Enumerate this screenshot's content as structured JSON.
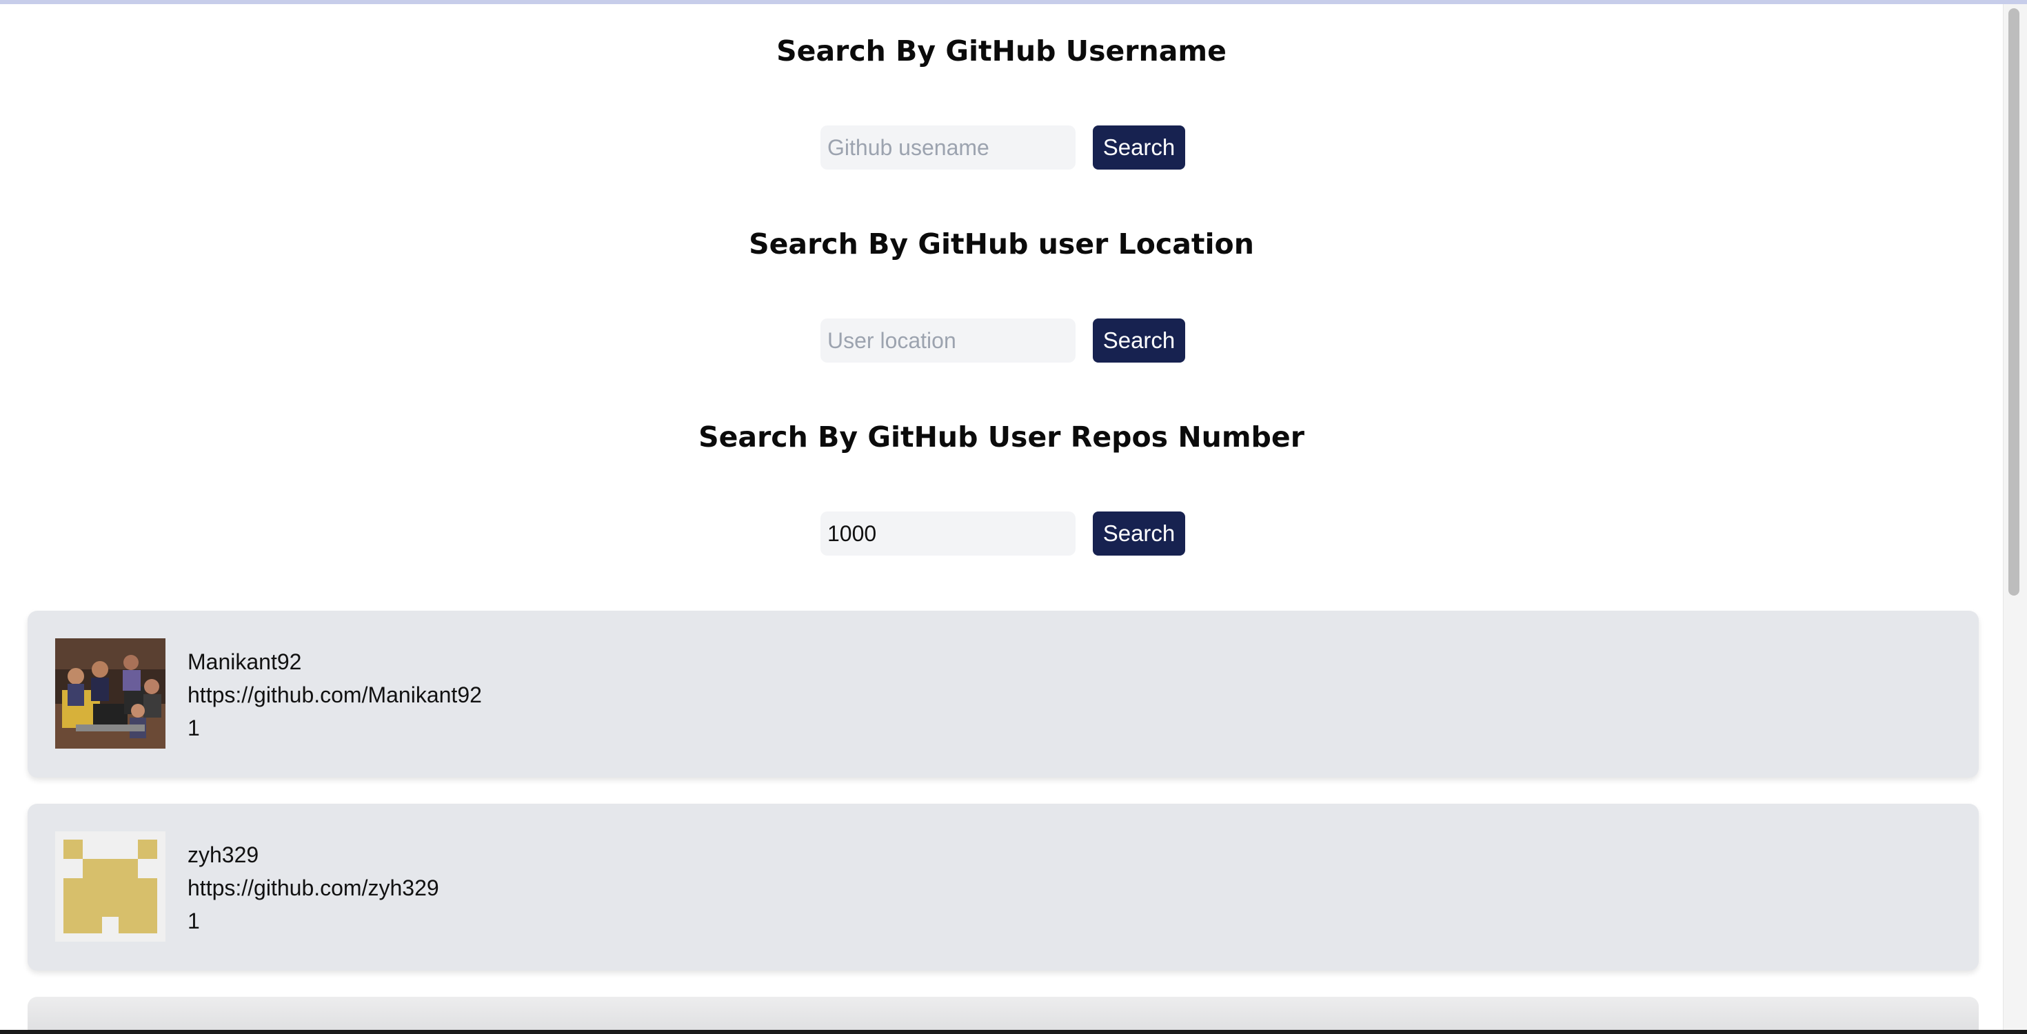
{
  "sections": [
    {
      "title": "Search By GitHub Username",
      "input_value": "",
      "input_placeholder": "Github usename",
      "button_label": "Search"
    },
    {
      "title": "Search By GitHub user Location",
      "input_value": "",
      "input_placeholder": "User location",
      "button_label": "Search"
    },
    {
      "title": "Search By GitHub User Repos Number",
      "input_value": "1000",
      "input_placeholder": "",
      "button_label": "Search"
    }
  ],
  "results": [
    {
      "username": "Manikant92",
      "profile_url": "https://github.com/Manikant92",
      "repos": "1",
      "avatar_icon": "group-photo-avatar"
    },
    {
      "username": "zyh329",
      "profile_url": "https://github.com/zyh329",
      "repos": "1",
      "avatar_icon": "identicon-avatar"
    }
  ],
  "colors": {
    "button_bg": "#172250",
    "input_bg": "#f3f4f6",
    "card_bg": "#e5e7eb",
    "identicon": "#d7bf6b"
  }
}
